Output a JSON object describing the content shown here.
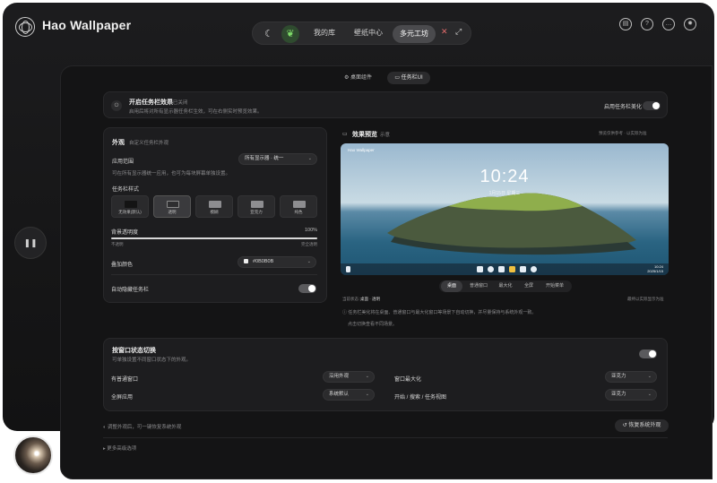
{
  "app": {
    "title": "Hao Wallpaper"
  },
  "nav": {
    "tabs": [
      "我的库",
      "壁纸中心",
      "多元工坊"
    ],
    "active": "多元工坊"
  },
  "header_icons": [
    "clipboard-icon",
    "help-icon",
    "chat-icon",
    "gear-icon"
  ],
  "segment": {
    "options": [
      "桌面组件",
      "任务栏UI"
    ],
    "active": "任务栏UI"
  },
  "enable_card": {
    "title": "开启任务栏效果",
    "status": "● 已关闭",
    "desc": "启用后将对所有显示器任务栏生效，可在右侧实时预览效果。",
    "toggle_label": "启用任务栏美化"
  },
  "appearance": {
    "title": "外观",
    "subtitle": "自定义任务栏外观",
    "scope_label": "应用范围",
    "scope_value": "所有显示器 · 统一",
    "scope_hint": "可在所有显示器统一应用，也可为每块屏幕单独设置。",
    "style_label": "任务栏样式",
    "styles": [
      "无效果(默认)",
      "透明",
      "模糊",
      "亚克力",
      "纯色"
    ],
    "style_selected": "透明",
    "opacity_label": "背景透明度",
    "opacity_value": "100%",
    "opacity_fraction": 1.0,
    "opacity_min": "不透明",
    "opacity_max": "完全透明",
    "color_label": "叠加颜色",
    "color_value": "#0B0B0B",
    "autohide_label": "自动隐藏任务栏"
  },
  "preview": {
    "title": "效果预览",
    "subtitle": "示意",
    "note": "预览仅供参考 · 以实际为准",
    "clock": "10:24",
    "date": "1月15日 星期三",
    "top_left": "Hao Wallpaper",
    "tray_time": "10:24",
    "tray_date": "2025/1/15",
    "tabs": [
      "桌面",
      "普通窗口",
      "最大化",
      "全屏",
      "开始菜单"
    ],
    "active_tab": "桌面",
    "info_left": "当前状态：",
    "info_mid": "桌面 · 透明",
    "info_right": "最终以实际显示为准",
    "tip": "任务栏美化将在桌面、普通窗口与最大化窗口等场景下自动切换，并尽量保持与系统外观一致。",
    "tip2": "点击切换查看不同场景。"
  },
  "window_state": {
    "title": "按窗口状态切换",
    "subtitle": "可单独设置不同窗口状态下的外观。",
    "rows": [
      {
        "label": "有普通窗口",
        "value": "沿用外观"
      },
      {
        "label": "窗口最大化",
        "value": "亚克力"
      },
      {
        "label": "全屏应用",
        "value": "系统默认"
      },
      {
        "label": "开始 / 搜索 / 任务视图",
        "value": "亚克力"
      }
    ]
  },
  "footer": {
    "hint": "◐ 调整外观后，可一键恢复系统外观",
    "restore": "恢复系统外观",
    "more": "▸ 更多高级选项"
  },
  "side_button": "pause-icon"
}
